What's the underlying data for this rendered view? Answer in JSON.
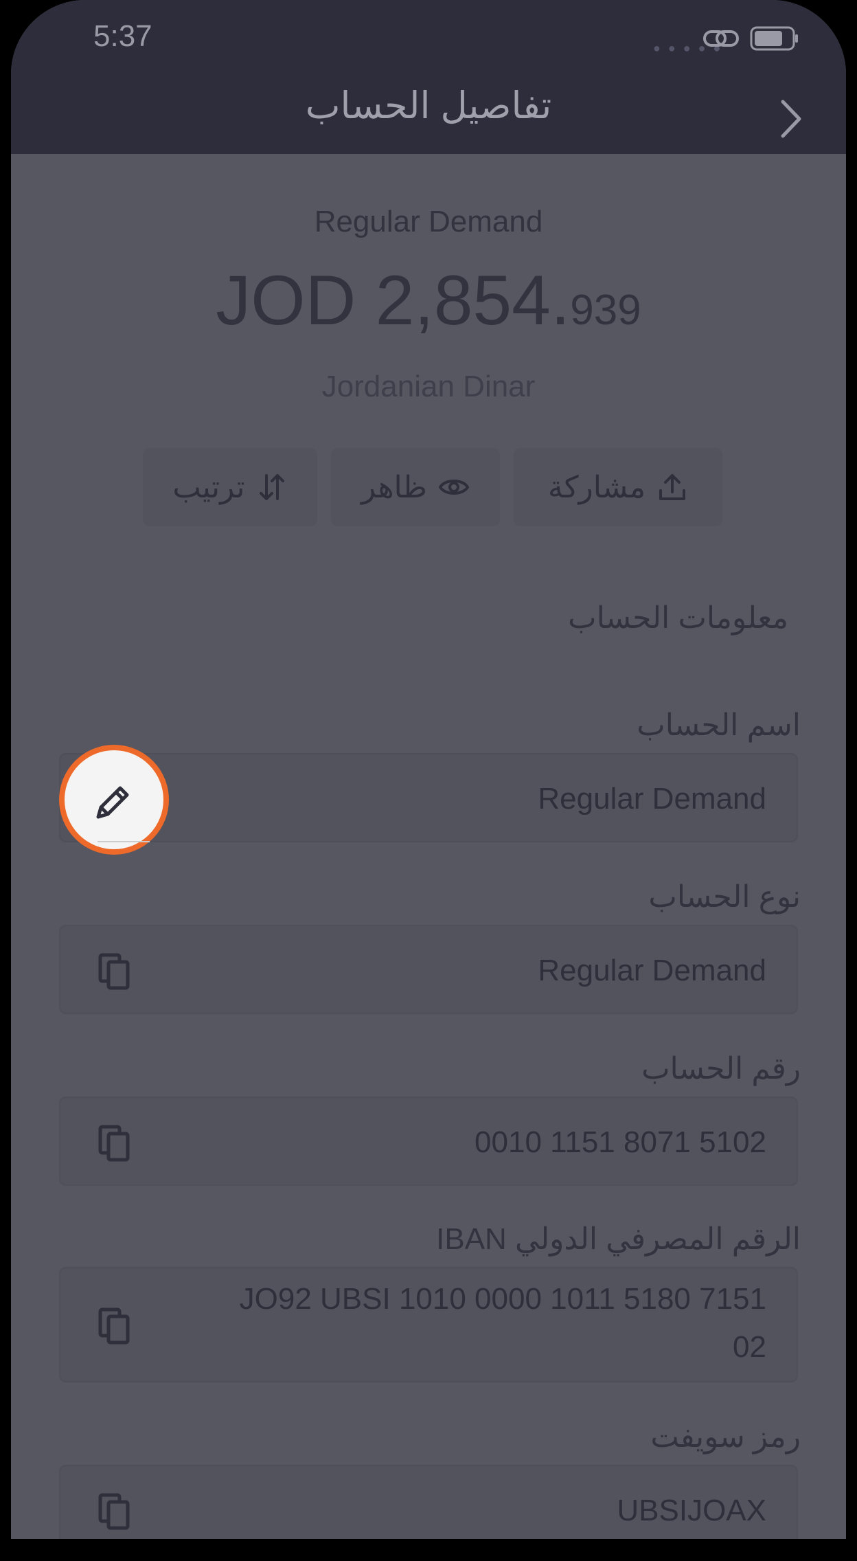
{
  "status_bar": {
    "time": "5:37"
  },
  "nav": {
    "title": "تفاصيل الحساب"
  },
  "account": {
    "name": "Regular Demand",
    "balance_main": "JOD 2,854.",
    "balance_decimal": "939",
    "currency_name": "Jordanian Dinar"
  },
  "actions": [
    {
      "label": "مشاركة",
      "icon": "share-icon"
    },
    {
      "label": "ظاهر",
      "icon": "eye-icon"
    },
    {
      "label": "ترتيب",
      "icon": "sort-icon"
    }
  ],
  "section": {
    "title": "معلومات الحساب"
  },
  "fields": [
    {
      "label": "اسم الحساب",
      "value": "Regular Demand",
      "icon": "pencil-icon"
    },
    {
      "label": "نوع الحساب",
      "value": "Regular Demand",
      "icon": "copy-icon"
    },
    {
      "label": "رقم الحساب",
      "value": "0010 1151 8071 5102",
      "icon": "copy-icon"
    },
    {
      "label": "الرقم المصرفي الدولي IBAN",
      "value_line1": "JO92 UBSI 1010 0000 1011 5180 7151",
      "value_line2": "02",
      "icon": "copy-icon"
    },
    {
      "label": "رمز سويفت",
      "value": "UBSIJOAX",
      "icon": "copy-icon"
    }
  ],
  "colors": {
    "overlay": "#575761",
    "nav_bar": "#2d2d3b",
    "highlight_ring": "#ee6a2a",
    "button_bg": "#f4f4f4"
  }
}
